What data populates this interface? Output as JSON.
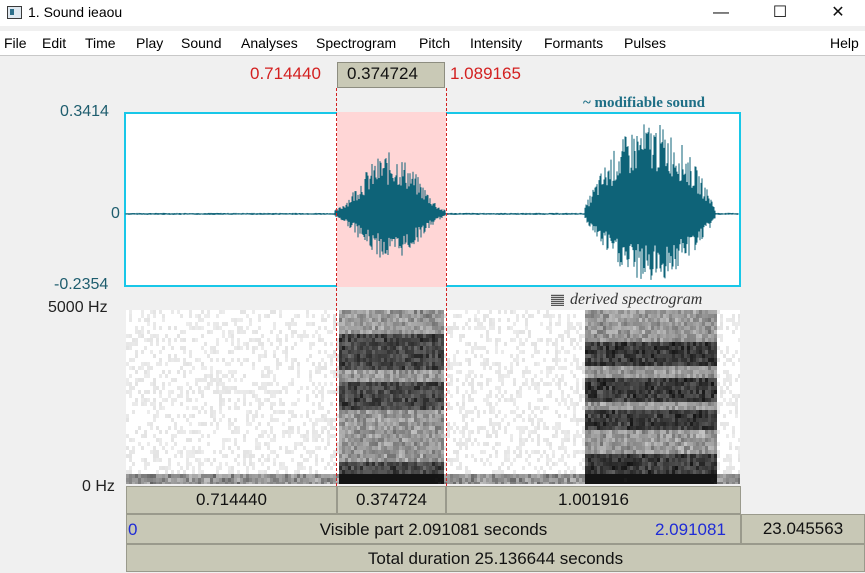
{
  "window": {
    "title": "1. Sound ieaou",
    "minimize": "—",
    "maximize": "☐",
    "close": "✕"
  },
  "menu": [
    "File",
    "Edit",
    "Time",
    "Play",
    "Sound",
    "Analyses",
    "Spectrogram",
    "Pitch",
    "Intensity",
    "Formants",
    "Pulses",
    "Help"
  ],
  "selection": {
    "start": "0.714440",
    "duration": "0.374724",
    "end": "1.089165"
  },
  "waveform": {
    "label": "~ modifiable sound",
    "y_max": "0.3414",
    "y_zero": "0",
    "y_min": "-0.2354",
    "color": "#0e6378",
    "border_color": "#18c7e8",
    "selection_color": "#ffd6d6"
  },
  "spectrogram": {
    "label": "derived spectrogram",
    "f_max": "5000 Hz",
    "f_min": "0 Hz"
  },
  "time_bars": {
    "before": "0.714440",
    "selection": "0.374724",
    "after": "1.001916",
    "visible_start": "0",
    "visible_label": "Visible part 2.091081 seconds",
    "visible_end": "2.091081",
    "remaining": "23.045563",
    "total": "Total duration 25.136644 seconds"
  },
  "colors": {
    "selection_marker": "#d32020",
    "time_link": "#1f2bd6"
  }
}
